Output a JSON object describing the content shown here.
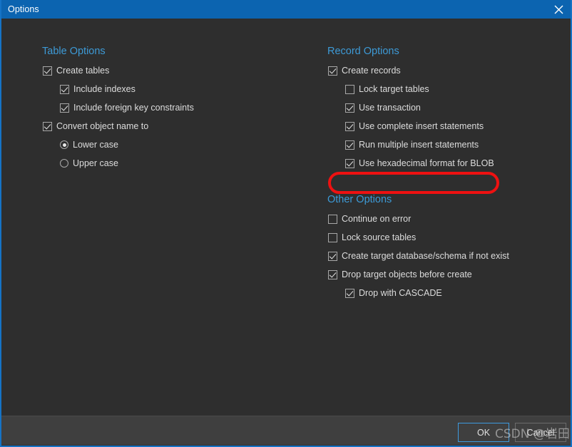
{
  "window": {
    "title": "Options",
    "close_icon": "close-icon",
    "accent_color": "#0c64b0",
    "background_color": "#2e2e2e",
    "header_text_color": "#3d9ad6",
    "annotation_color": "#ee1111"
  },
  "sections": {
    "table_options": {
      "title": "Table Options",
      "items": [
        {
          "label": "Create tables",
          "type": "checkbox",
          "checked": true,
          "indent": 0
        },
        {
          "label": "Include indexes",
          "type": "checkbox",
          "checked": true,
          "indent": 1
        },
        {
          "label": "Include foreign key constraints",
          "type": "checkbox",
          "checked": true,
          "indent": 1
        },
        {
          "label": "Convert object name to",
          "type": "checkbox",
          "checked": true,
          "indent": 0
        },
        {
          "label": "Lower case",
          "type": "radio",
          "checked": true,
          "indent": 1
        },
        {
          "label": "Upper case",
          "type": "radio",
          "checked": false,
          "indent": 1
        }
      ]
    },
    "record_options": {
      "title": "Record Options",
      "items": [
        {
          "label": "Create records",
          "type": "checkbox",
          "checked": true,
          "indent": 0
        },
        {
          "label": "Lock target tables",
          "type": "checkbox",
          "checked": false,
          "indent": 1
        },
        {
          "label": "Use transaction",
          "type": "checkbox",
          "checked": true,
          "indent": 1
        },
        {
          "label": "Use complete insert statements",
          "type": "checkbox",
          "checked": true,
          "indent": 1
        },
        {
          "label": "Run multiple insert statements",
          "type": "checkbox",
          "checked": true,
          "indent": 1
        },
        {
          "label": "Use hexadecimal format for BLOB",
          "type": "checkbox",
          "checked": true,
          "indent": 1,
          "highlighted": true
        }
      ]
    },
    "other_options": {
      "title": "Other Options",
      "items": [
        {
          "label": "Continue on error",
          "type": "checkbox",
          "checked": false,
          "indent": 0
        },
        {
          "label": "Lock source tables",
          "type": "checkbox",
          "checked": false,
          "indent": 0
        },
        {
          "label": "Create target database/schema if not exist",
          "type": "checkbox",
          "checked": true,
          "indent": 0
        },
        {
          "label": "Drop target objects before create",
          "type": "checkbox",
          "checked": true,
          "indent": 0
        },
        {
          "label": "Drop with CASCADE",
          "type": "checkbox",
          "checked": true,
          "indent": 1
        }
      ]
    }
  },
  "footer": {
    "ok_label": "OK",
    "cancel_label": "Cancel"
  },
  "watermark": {
    "text": "CSDN @岩田瞬"
  }
}
